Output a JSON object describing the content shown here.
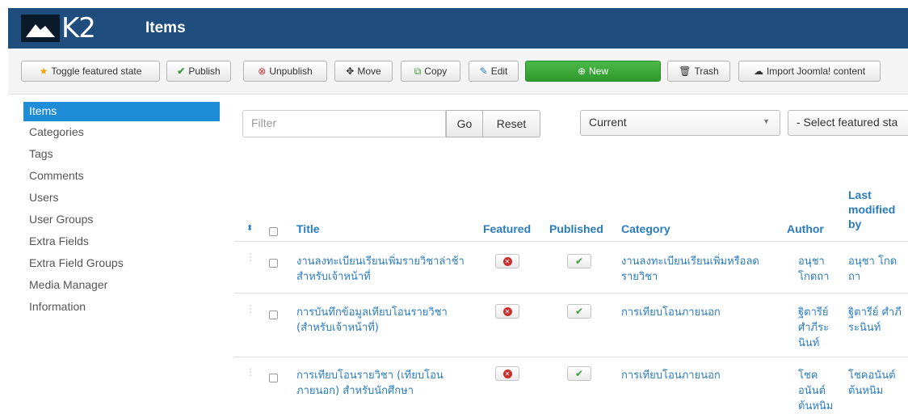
{
  "header": {
    "brand": "K2",
    "title": "Items"
  },
  "toolbar": {
    "toggle_featured": "Toggle featured state",
    "publish": "Publish",
    "unpublish": "Unpublish",
    "move": "Move",
    "copy": "Copy",
    "edit": "Edit",
    "new": "New",
    "trash": "Trash",
    "import": "Import Joomla! content"
  },
  "sidebar": {
    "items": [
      {
        "label": "Items"
      },
      {
        "label": "Categories"
      },
      {
        "label": "Tags"
      },
      {
        "label": "Comments"
      },
      {
        "label": "Users"
      },
      {
        "label": "User Groups"
      },
      {
        "label": "Extra Fields"
      },
      {
        "label": "Extra Field Groups"
      },
      {
        "label": "Media Manager"
      },
      {
        "label": "Information"
      }
    ]
  },
  "filter": {
    "placeholder": "Filter",
    "go": "Go",
    "reset": "Reset",
    "state_select": "Current",
    "featured_select": "- Select featured sta"
  },
  "table": {
    "columns": {
      "title": "Title",
      "featured": "Featured",
      "published": "Published",
      "category": "Category",
      "author": "Author",
      "modified": "Last modified by"
    },
    "rows": [
      {
        "title": "งานลงทะเบียนเรียนเพิ่มรายวิชาล่าช้า สำหรับเจ้าหน้าที่",
        "category": "งานลงทะเบียนเรียนเพิ่มหรือลดรายวิชา",
        "author": "อนุชา โกดถา",
        "modified": "อนุชา โกดถา",
        "featured": false,
        "published": true
      },
      {
        "title": "การบันทึกข้อมูลเทียบโอนรายวิชา (สำหรับเจ้าหน้าที่)",
        "category": "การเทียบโอนภายนอก",
        "author": "ฐิตารีย์ ศำภีระนินท์",
        "modified": "ฐิตารีย์ ศำภีระนินท์",
        "featured": false,
        "published": true
      },
      {
        "title": "การเทียบโอนรายวิชา (เทียบโอนภายนอก) สำหรับนักศึกษา",
        "category": "การเทียบโอนภายนอก",
        "author": "โชคอนันต์ ต้นหนิม",
        "modified": "โชคอนันต์ ต้นหนิม",
        "featured": false,
        "published": true
      }
    ]
  }
}
